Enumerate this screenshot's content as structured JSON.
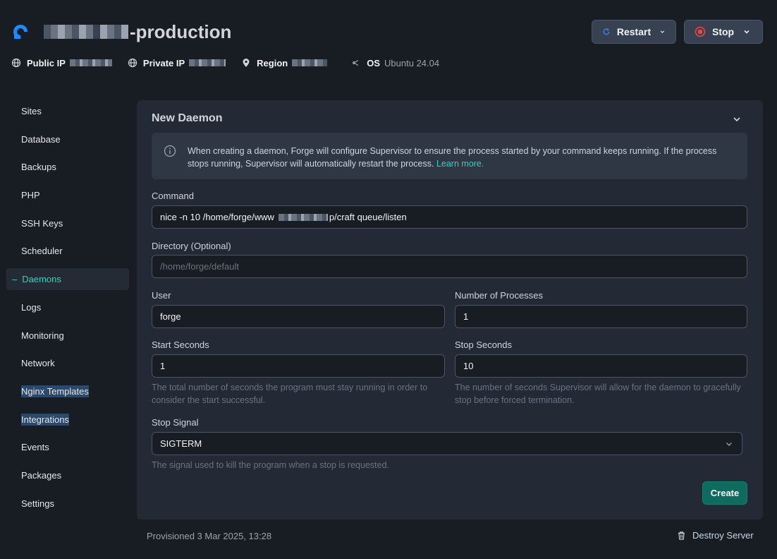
{
  "header": {
    "server_name_suffix": "-production",
    "restart_label": "Restart",
    "stop_label": "Stop"
  },
  "meta": {
    "public_ip_label": "Public IP",
    "private_ip_label": "Private IP",
    "region_label": "Region",
    "os_label": "OS",
    "os_value": "Ubuntu 24.04"
  },
  "sidebar": {
    "items": [
      {
        "label": "Sites"
      },
      {
        "label": "Database"
      },
      {
        "label": "Backups"
      },
      {
        "label": "PHP"
      },
      {
        "label": "SSH Keys"
      },
      {
        "label": "Scheduler"
      },
      {
        "label": "Daemons",
        "active": true
      },
      {
        "label": "Logs"
      },
      {
        "label": "Monitoring"
      },
      {
        "label": "Network"
      },
      {
        "label": "Nginx Templates"
      },
      {
        "label": "Integrations"
      },
      {
        "label": "Events"
      },
      {
        "label": "Packages"
      },
      {
        "label": "Settings"
      }
    ]
  },
  "form": {
    "title": "New Daemon",
    "info_text": "When creating a daemon, Forge will configure Supervisor to ensure the process started by your command keeps running. If the process stops running, Supervisor will automatically restart the process.",
    "info_link": "Learn more.",
    "command_label": "Command",
    "command_prefix": "nice -n 10 /home/forge/www",
    "command_suffix": "p/craft queue/listen",
    "directory_label": "Directory (Optional)",
    "directory_placeholder": "/home/forge/default",
    "user_label": "User",
    "user_value": "forge",
    "processes_label": "Number of Processes",
    "processes_value": "1",
    "start_seconds_label": "Start Seconds",
    "start_seconds_value": "1",
    "start_seconds_help": "The total number of seconds the program must stay running in order to consider the start successful.",
    "stop_seconds_label": "Stop Seconds",
    "stop_seconds_value": "10",
    "stop_seconds_help": "The number of seconds Supervisor will allow for the daemon to gracefully stop before forced termination.",
    "stop_signal_label": "Stop Signal",
    "stop_signal_value": "SIGTERM",
    "stop_signal_help": "The signal used to kill the program when a stop is requested.",
    "create_label": "Create"
  },
  "footer": {
    "provisioned": "Provisioned 3 Mar 2025, 13:28",
    "destroy_label": "Destroy Server"
  },
  "colors": {
    "accent": "#2dd4bf",
    "background": "#181c23",
    "card": "#232935",
    "create_button": "#0f6b5e",
    "stop_icon": "#ef4444",
    "restart_icon": "#3b82f6"
  }
}
